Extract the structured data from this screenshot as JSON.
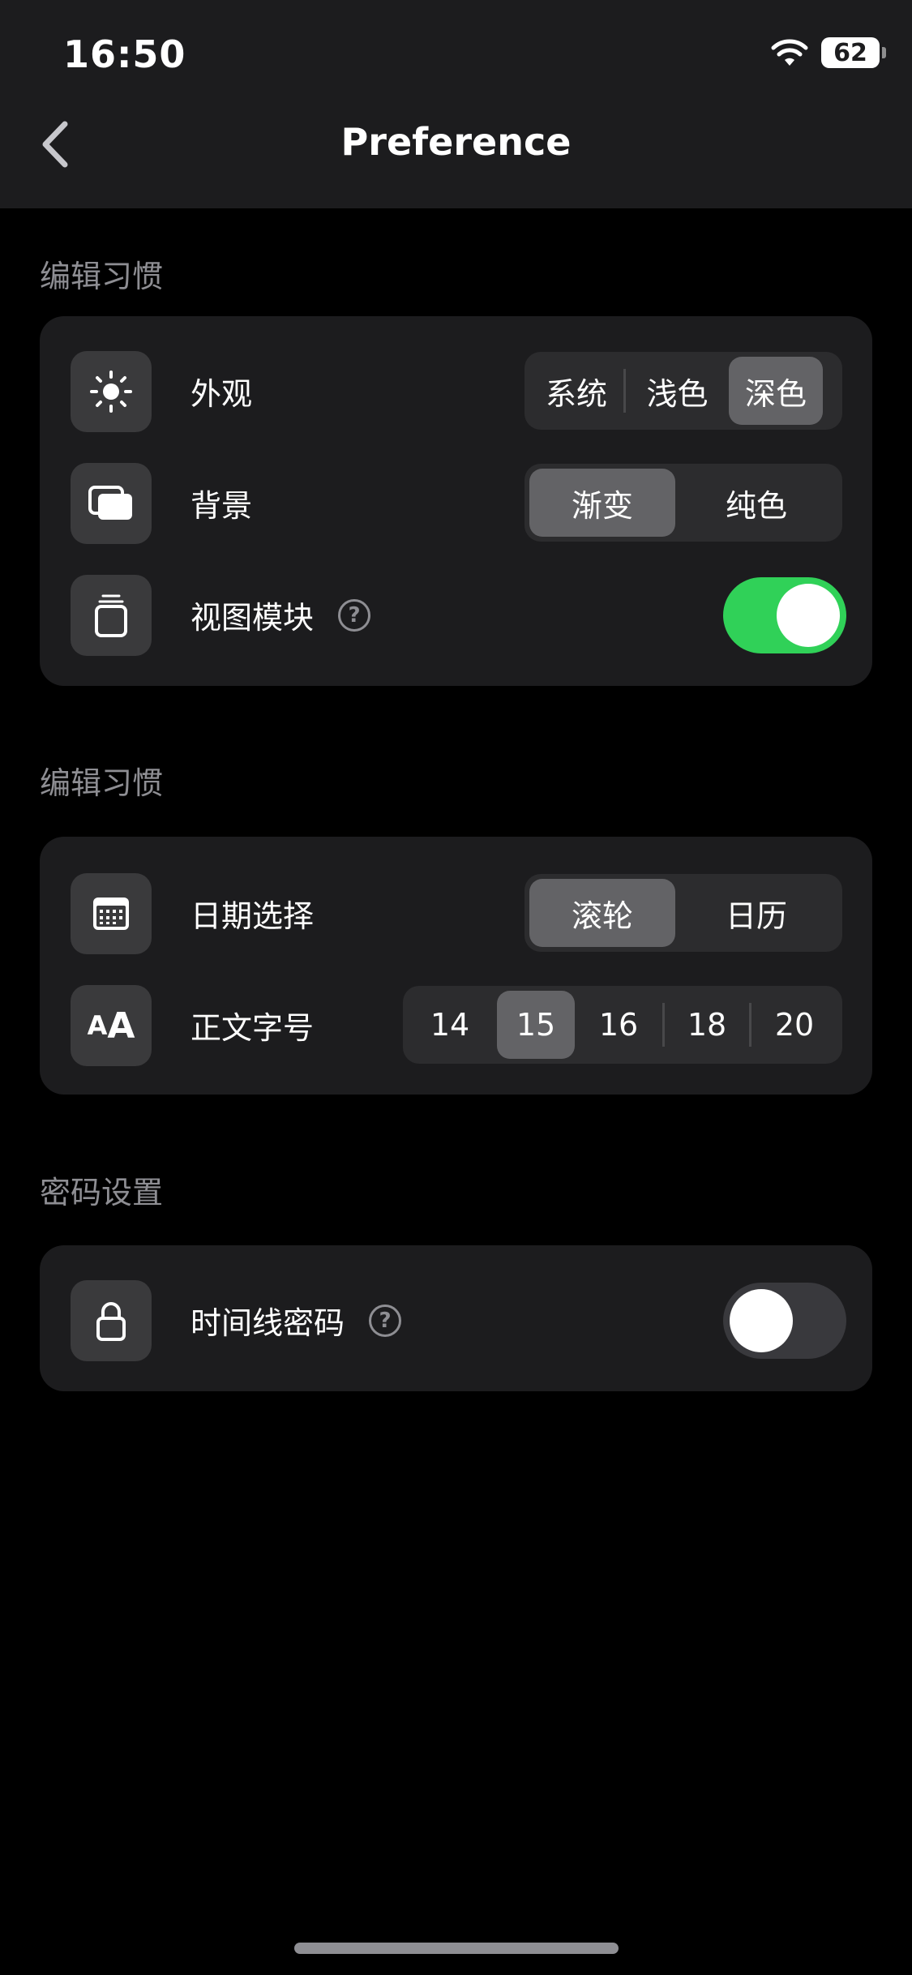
{
  "status_bar": {
    "time": "16:50",
    "battery": "62"
  },
  "nav": {
    "title": "Preference"
  },
  "section1": {
    "title": "编辑习惯",
    "rows": [
      {
        "label": "外观",
        "options": [
          "系统",
          "浅色",
          "深色"
        ],
        "selected": "深色"
      },
      {
        "label": "背景",
        "options": [
          "渐变",
          "纯色"
        ],
        "selected": "渐变"
      },
      {
        "label": "视图模块",
        "help": "?",
        "toggle": true
      }
    ]
  },
  "section2": {
    "title": "编辑习惯",
    "rows": [
      {
        "label": "日期选择",
        "options": [
          "滚轮",
          "日历"
        ],
        "selected": "滚轮"
      },
      {
        "label": "正文字号",
        "icon_text": "AA",
        "options": [
          "14",
          "15",
          "16",
          "18",
          "20"
        ],
        "selected": "15"
      }
    ]
  },
  "section3": {
    "title": "密码设置",
    "rows": [
      {
        "label": "时间线密码",
        "help": "?",
        "toggle": false
      }
    ]
  },
  "colors": {
    "toggle_on": "#30d158",
    "card_bg": "#1c1c1e",
    "header_bg": "#1c1c1e",
    "segment_active": "#636366"
  },
  "icons": [
    "back-chevron-icon",
    "wifi-icon",
    "sun-icon",
    "background-layers-icon",
    "view-module-icon",
    "calendar-icon",
    "font-size-icon",
    "lock-icon",
    "help-icon"
  ]
}
